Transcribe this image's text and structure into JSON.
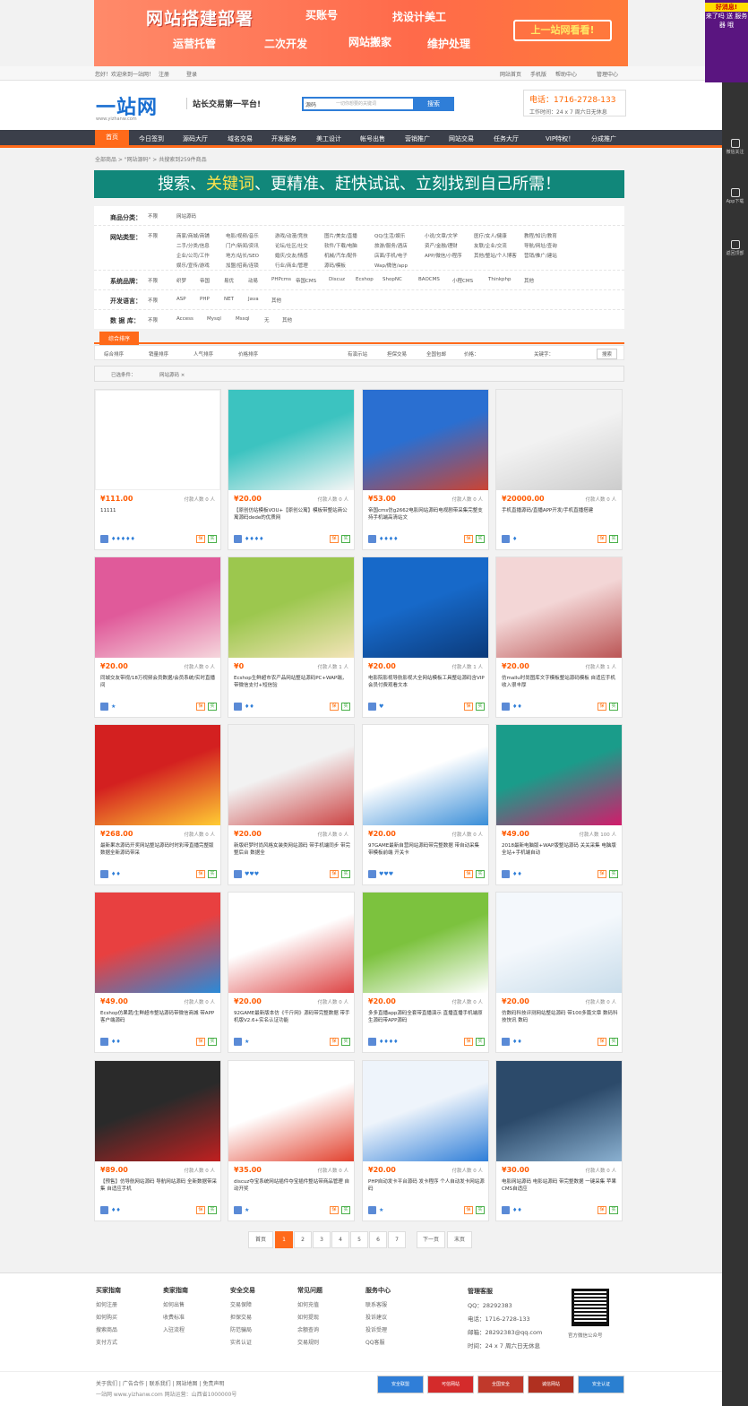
{
  "banner": {
    "title": "网站搭建部署",
    "links": [
      "买账号",
      "找设计美工",
      "运营托管",
      "二次开发",
      "网站搬家",
      "维护处理"
    ],
    "cta": "上一站网看看!"
  },
  "topbar": {
    "welcome": "您好！欢迎来到一站网！",
    "register": "注册",
    "login": "登录",
    "right": [
      "网站首页",
      "手机版",
      "帮助中心",
      "管理中心"
    ]
  },
  "header": {
    "logo": "一站网",
    "logo_sub": "www.yizhanw.com",
    "slogan": "站长交易第一平台!",
    "search_type": "源码",
    "search_placeholder": "一切你想要的关键词",
    "search_button": "搜索",
    "tel": "电话：1716-2728-133",
    "worktime": "工作时间：24 x 7 周六日无休息"
  },
  "nav": [
    "首页",
    "今日签到",
    "源码大厅",
    "域名交易",
    "开发服务",
    "美工设计",
    "帐号出售",
    "营销推广",
    "网站交易",
    "任务大厅",
    "VIP特权！",
    "分成推广"
  ],
  "breadcrumb": "全部商品 > \"网站源码\" > 共搜索到259件商品",
  "keyword_banner": {
    "pre": "搜索、",
    "hl": "关键词",
    "post": "、更精准、赶快试试、立刻找到自己所需！"
  },
  "filters": [
    {
      "label": "商品分类：",
      "options": [
        "不限",
        "网站源码"
      ]
    },
    {
      "label": "网站类型：",
      "options": [
        "不限",
        "商家/商城/商铺",
        "电影/视频/音乐",
        "游戏/动漫/竞技",
        "图片/美女/直播",
        "QQ/生活/娱乐",
        "小说/文章/文学",
        "医疗/女人/健康",
        "教程/知识/教育",
        "二手/分类/信息",
        "门户/新闻/资讯",
        "论坛/社区/社交",
        "软件/下载/电脑",
        "旅游/服务/酒店",
        "资产/金融/理财",
        "友联/企业/交流",
        "导航/网址/查询",
        "企业/公司/工作",
        "地方/站长/SEO",
        "婚庆/交友/情感",
        "机械/汽车/配件",
        "店面/手机/电子",
        "APP/微信/小程序",
        "其他/整站/个人博客",
        "营销/推广/建站",
        "娱乐/宣传/游戏",
        "加盟/招商/连锁",
        "行业/商业/管理",
        "源码/模板",
        "Wap/微信/app"
      ]
    },
    {
      "label": "系统品牌：",
      "options": [
        "不限",
        "织梦",
        "帝国",
        "易优",
        "动易",
        "PHPcms",
        "帝国CMS",
        "Discuz",
        "Ecshop",
        "ShopNC",
        "BAOCMS",
        "小程CMS",
        "Thinkphp",
        "其他"
      ]
    },
    {
      "label": "开发语言：",
      "options": [
        "不限",
        "ASP",
        "PHP",
        "NET",
        "Java",
        "其他"
      ]
    },
    {
      "label": "数 据 库：",
      "options": [
        "不限",
        "Access",
        "Mysql",
        "Mssql",
        "无",
        "其他"
      ]
    }
  ],
  "tab": "综合排序",
  "sortbar": {
    "items": [
      "综合排序",
      "销量排序",
      "人气排序",
      "价格排序"
    ],
    "checks": [
      "有演示站",
      "担保交易",
      "全国包邮"
    ],
    "price_label": "价格：",
    "keyword_label": "关键字：",
    "go": "搜索"
  },
  "condition": {
    "label": "已选条件：",
    "value": "网站源码 ×"
  },
  "products": [
    {
      "price": "¥111.00",
      "buy": "付款人数 0 人",
      "title": "11111",
      "level": "♦♦♦♦♦",
      "img": "blank"
    },
    {
      "price": "¥20.00",
      "buy": "付款人数 0 人",
      "title": "【原创仿站模板VOU+【原创公寓】模板带整站商公寓源码dede的优质网",
      "level": "♦♦♦♦",
      "img": "uoko"
    },
    {
      "price": "¥53.00",
      "buy": "付款人数 0 人",
      "title": "帝国cms仿g2662电影网站源码电视剧带采集完整支持手机端高清站文",
      "level": "♦♦♦♦",
      "img": "movie"
    },
    {
      "price": "¥20000.00",
      "buy": "付款人数 0 人",
      "title": "手机直播源码/直播APP开发/手机直播搭建",
      "level": "♦",
      "img": "live"
    },
    {
      "price": "¥20.00",
      "buy": "付款人数 0 人",
      "title": "同城交友带视/18万视频会员数据/会员系统/实时直播间",
      "level": "★",
      "img": "dating"
    },
    {
      "price": "¥0",
      "buy": "付款人数 1 人",
      "title": "Ecshop生鲜超市农产品网站整站源码PC+WAP端，带微信支付+短信验",
      "level": "♦♦",
      "img": "fruit"
    },
    {
      "price": "¥20.00",
      "buy": "付款人数 1 人",
      "title": "电影院影视导航影视大全网站模板工具整站源码含VIP会员付费观看文本",
      "level": "♥",
      "img": "cinema"
    },
    {
      "price": "¥20.00",
      "buy": "付款人数 1 人",
      "title": "仿mallu时尚图库文字模板整站源码模板 自适应手机 收入很丰厚",
      "level": "♦♦",
      "img": "gallery"
    },
    {
      "price": "¥268.00",
      "buy": "付款人数 0 人",
      "title": "最新果冻源码开奖网站整站源码时时彩带直播完整版 数据全新源码带采",
      "level": "♦♦",
      "img": "lottery"
    },
    {
      "price": "¥20.00",
      "buy": "付款人数 0 人",
      "title": "新版织梦时尚风格女装类网站源码 带手机端同步 带完整后台 数据全",
      "level": "♥♥♥",
      "img": "fashion"
    },
    {
      "price": "¥20.00",
      "buy": "付款人数 0 人",
      "title": "97GAME最新自营网站源码带完整数据 带自动采集 带模板前端 开关卡",
      "level": "♥♥♥",
      "img": "game"
    },
    {
      "price": "¥49.00",
      "buy": "付款人数 100 人",
      "title": "2018最新电脑版+WAP版整站源码 关关采集 电脑版全站+手机端自动",
      "level": "♦♦",
      "img": "novel"
    },
    {
      "price": "¥49.00",
      "buy": "付款人数 0 人",
      "title": "Ecshop仿果蔬/生鲜超市整站源码带微信商城 带APP客户端源码",
      "level": "♦♦",
      "img": "market"
    },
    {
      "price": "¥20.00",
      "buy": "付款人数 0 人",
      "title": "92GAME最新版本仿《千斤网》源码带完整数据 带手机版V2.6+实名认证功能",
      "level": "★",
      "img": "news"
    },
    {
      "price": "¥20.00",
      "buy": "付款人数 0 人",
      "title": "多多直播app源码全套带直播演示 直播直播手机端原生源码带APP源码",
      "level": "♦♦♦♦",
      "img": "liveapp"
    },
    {
      "price": "¥20.00",
      "buy": "付款人数 0 人",
      "title": "仿数码科技评测网站整站源码 带100多篇文章 数码科技快讯 数码",
      "level": "♦♦",
      "img": "tech"
    },
    {
      "price": "¥89.00",
      "buy": "付款人数 0 人",
      "title": "【预售】仿导航网站源码 导航网站源码 全新数据带采集 自适应手机",
      "level": "♦♦",
      "img": "sexys"
    },
    {
      "price": "¥35.00",
      "buy": "付款人数 0 人",
      "title": "discuz夺宝系统网站插件夺宝插件整站带商品管理 自动开奖",
      "level": "★",
      "img": "plugin"
    },
    {
      "price": "¥20.00",
      "buy": "付款人数 0 人",
      "title": "PHP自动发卡平台源码 发卡程序 个人自动发卡网站源码",
      "level": "★",
      "img": "card"
    },
    {
      "price": "¥30.00",
      "buy": "付款人数 0 人",
      "title": "电影网站源码 电影站源码 带完整数据 一键采集 苹果CMS自适应",
      "level": "♦♦",
      "img": "film"
    }
  ],
  "pager": [
    "首页",
    "1",
    "2",
    "3",
    "4",
    "5",
    "6",
    "7",
    "下一页",
    "末页"
  ],
  "footer": {
    "cols": [
      {
        "h": "买家指南",
        "items": [
          "如何注册",
          "如何购买",
          "搜索商品",
          "支付方式"
        ]
      },
      {
        "h": "卖家指南",
        "items": [
          "如何出售",
          "收费标准",
          "入驻流程"
        ]
      },
      {
        "h": "安全交易",
        "items": [
          "交易保障",
          "担保交易",
          "防范骗局",
          "实名认证"
        ]
      },
      {
        "h": "常见问题",
        "items": [
          "如何充值",
          "如何提现",
          "余额查询",
          "交易规则"
        ]
      },
      {
        "h": "服务中心",
        "items": [
          "联系客服",
          "投诉建议",
          "投诉受理",
          "QQ客服"
        ]
      }
    ],
    "contact_h": "管理客服",
    "qq": "QQ：28292383",
    "tel": "电话：1716-2728-133",
    "email": "邮箱：28292383@qq.com",
    "time": "时间：24 x 7 周六日无休息",
    "qr_label": "官方微信公众号",
    "copyright1": "关于我们 | 广告合作 | 联系我们 | 网站地图 | 免责声明",
    "copyright2": "一站网 www.yizhanw.com 网站运营：山西省1000000号",
    "badges": [
      "安全联盟",
      "可信网站",
      "全国安全",
      "诚信网站",
      "安全认证"
    ]
  },
  "rightbar": {
    "promo_head": "好消息!",
    "promo_text": "来了吗 送 服务器 哦",
    "items": [
      "微信关注",
      "App下载",
      "返回顶部"
    ]
  }
}
